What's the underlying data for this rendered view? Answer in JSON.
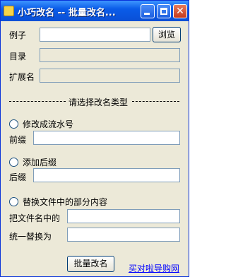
{
  "window": {
    "title": "小巧改名 -- 批量改名..."
  },
  "example": {
    "label": "例子",
    "value": "",
    "browse_label": "浏览"
  },
  "directory": {
    "label": "目录",
    "value": ""
  },
  "extension": {
    "label": "扩展名",
    "value": ""
  },
  "section_title": "请选择改名类型",
  "options": {
    "serial": {
      "label": "修改成流水号",
      "prefix_label": "前缀",
      "prefix_value": ""
    },
    "suffix": {
      "label": "添加后缀",
      "suffix_label": "后缀",
      "suffix_value": ""
    },
    "replace": {
      "label": "替换文件中的部分内容",
      "find_label": "把文件名中的",
      "find_value": "",
      "replace_label": "统一替换为",
      "replace_value": ""
    }
  },
  "action": {
    "label": "批量改名"
  },
  "footer_link": "买对啦导购网"
}
